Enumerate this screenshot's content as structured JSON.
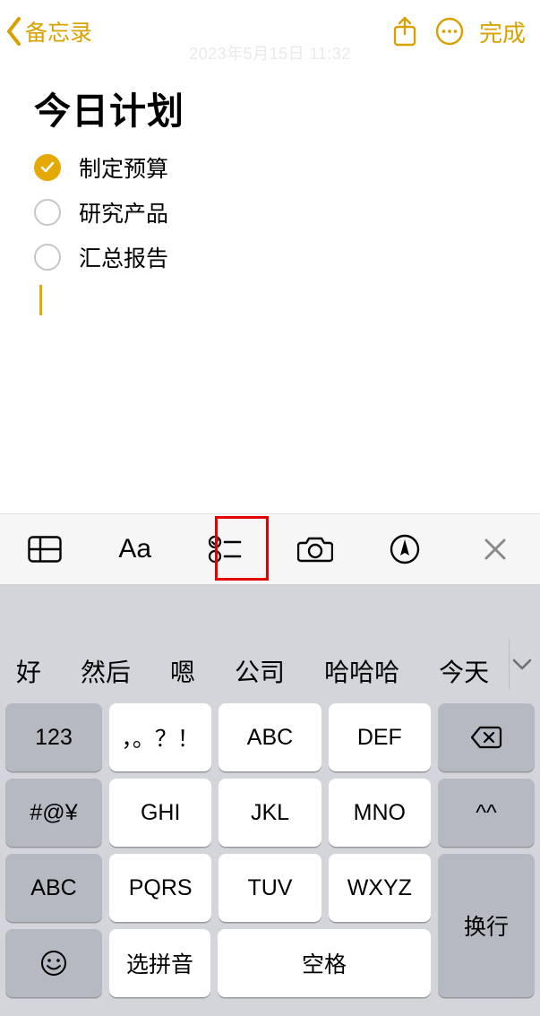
{
  "header": {
    "back_label": "备忘录",
    "done_label": "完成"
  },
  "timestamp": "2023年5月15日 11:32",
  "note": {
    "title": "今日计划",
    "todos": [
      {
        "text": "制定预算",
        "checked": true
      },
      {
        "text": "研究产品",
        "checked": false
      },
      {
        "text": "汇总报告",
        "checked": false
      }
    ]
  },
  "fmtbar": {
    "text_style_label": "Aa"
  },
  "ime": {
    "candidates": [
      "好",
      "然后",
      "嗯",
      "公司",
      "哈哈哈",
      "今天"
    ],
    "keys": {
      "num": "123",
      "punct": "，。？！",
      "sym": "#@¥",
      "abc_shift": "ABC",
      "abc": "ABC",
      "def": "DEF",
      "ghi": "GHI",
      "jkl": "JKL",
      "mno": "MNO",
      "pqrs": "PQRS",
      "tuv": "TUV",
      "wxyz": "WXYZ",
      "face": "^^",
      "pinyin": "选拼音",
      "space": "空格",
      "return": "换行"
    }
  }
}
